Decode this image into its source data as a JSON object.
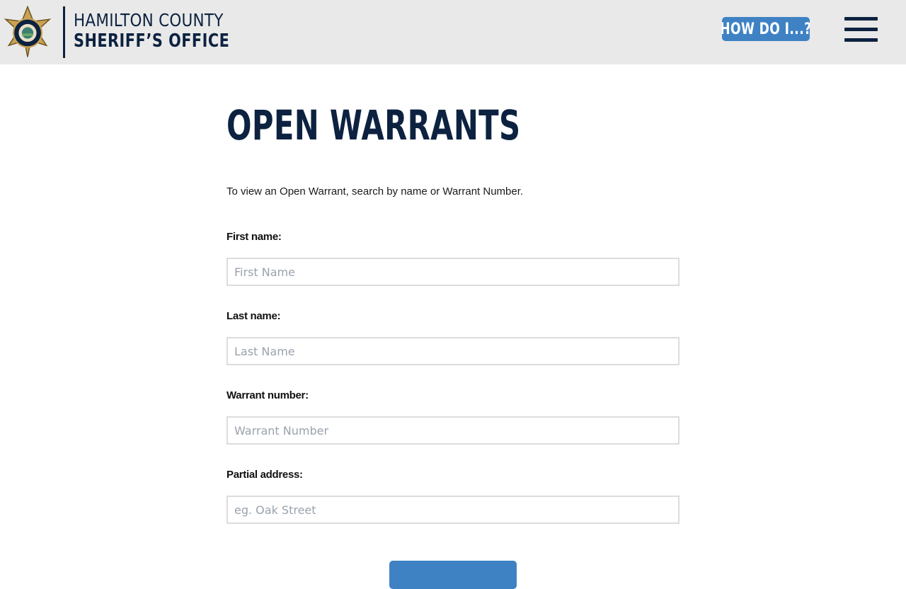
{
  "header": {
    "logo_line1": "HAMILTON COUNTY",
    "logo_line2": "SHERIFF’S OFFICE",
    "how_do_i_label": "HOW DO I...?",
    "menu_icon": "hamburger-menu-icon",
    "background_color": "#e9e9e9",
    "brand_color": "#0d2240",
    "accent_color": "#3f82c4"
  },
  "main": {
    "title": "OPEN WARRANTS",
    "intro": "To view an Open Warrant, search by name or Warrant Number.",
    "fields": [
      {
        "label": "First name:",
        "placeholder": "First Name",
        "value": ""
      },
      {
        "label": "Last name:",
        "placeholder": "Last Name",
        "value": ""
      },
      {
        "label": "Warrant number:",
        "placeholder": "Warrant Number",
        "value": ""
      },
      {
        "label": "Partial address:",
        "placeholder": "eg. Oak Street",
        "value": ""
      }
    ]
  }
}
